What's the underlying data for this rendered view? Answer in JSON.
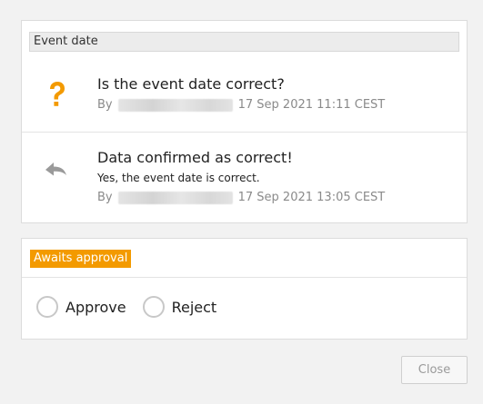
{
  "comments_panel": {
    "section_title": "Event date",
    "comments": [
      {
        "icon": "question-mark-icon",
        "icon_color": "#f39a00",
        "title": "Is the event date correct?",
        "body": "",
        "by_label": "By",
        "timestamp": "17 Sep 2021 11:11 CEST"
      },
      {
        "icon": "reply-arrow-icon",
        "icon_color": "#9a9a9a",
        "title": "Data confirmed as correct!",
        "body": "Yes, the event date is correct.",
        "by_label": "By",
        "timestamp": "17 Sep 2021 13:05 CEST"
      }
    ]
  },
  "approval_panel": {
    "status_badge": "Awaits approval",
    "status_color": "#f39a00",
    "options": [
      {
        "label": "Approve",
        "selected": false
      },
      {
        "label": "Reject",
        "selected": false
      }
    ]
  },
  "footer": {
    "close_label": "Close"
  }
}
